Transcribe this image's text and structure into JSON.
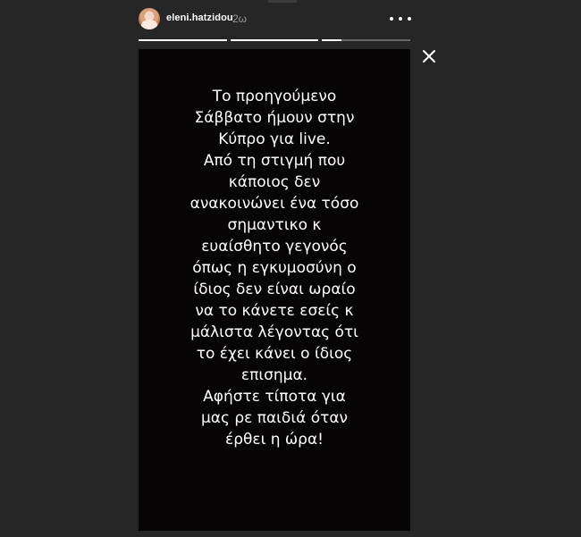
{
  "header": {
    "username": "eleni.hatzidou",
    "time_ago": "2ω"
  },
  "story": {
    "progress": [
      1,
      1,
      0.22
    ],
    "lines": [
      "Το προηγούμενο",
      "Σάββατο ήμουν στην",
      "Κύπρο για live.",
      "Από τη στιγμή που",
      "κάποιος δεν",
      "ανακοινώνει ένα τόσο",
      "σημαντικο κ",
      "ευαίσθητο γεγονός",
      "όπως η εγκυμοσύνη ο",
      "ίδιος δεν είναι ωραίο",
      "να το κάνετε εσείς κ",
      "μάλιστα λέγοντας ότι",
      "το έχει κάνει ο ίδιος",
      "επισημα.",
      "Αφήστε τίποτα για",
      "μας ρε παιδιά όταν",
      "έρθει η ώρα!"
    ]
  },
  "icons": {
    "more": "more-horizontal-icon",
    "close": "close-icon"
  },
  "colors": {
    "background": "#262626",
    "story_background": "#070406",
    "text": "#ffffff",
    "muted_text": "#9a9a9a"
  }
}
